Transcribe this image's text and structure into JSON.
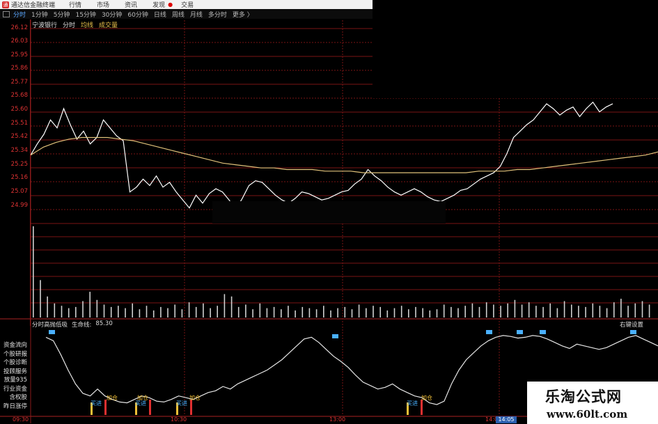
{
  "menu": {
    "title": "通达信金融终端",
    "items": [
      "行情",
      "市场",
      "资讯",
      "发现",
      "交易"
    ]
  },
  "period_tabs": [
    "分时",
    "1分钟",
    "5分钟",
    "15分钟",
    "30分钟",
    "60分钟",
    "日线",
    "周线",
    "月线",
    "多分时",
    "更多 〉"
  ],
  "active_tab": "分时",
  "stock_header": {
    "name": "宁波银行",
    "mode": "分时",
    "avg": "均线",
    "volume": "成交量"
  },
  "price_axis": [
    "26.12",
    "26.03",
    "25.95",
    "25.86",
    "25.77",
    "25.68",
    "25.60",
    "25.51",
    "25.42",
    "25.34",
    "25.25",
    "25.16",
    "25.07",
    "24.99"
  ],
  "indicator_header": {
    "name": "分时高抛低吸",
    "line_label": "生命线:",
    "line_value": "85.30"
  },
  "right_settings": "右键设置",
  "side_menu": [
    "资金流向",
    "个股研报",
    "个股诊断",
    "投顾服务",
    "放量935",
    "行业资金",
    "含权股",
    "昨日涨停"
  ],
  "time_axis": [
    "09:30",
    "10:30",
    "13:00",
    "14:00"
  ],
  "current_time": "14:05",
  "signals": {
    "buy_label": "买进",
    "add_label": "加仓"
  },
  "watermark": {
    "line1": "乐淘公式网",
    "line2": "www.60lt.com"
  },
  "colors": {
    "price_line": "#ffffff",
    "avg_line": "#e0c27a",
    "grid": "#7a1515",
    "axis_text": "#dd3333",
    "buy": "#4ab0ff",
    "add": "#f2c037"
  },
  "chart_data": {
    "type": "line",
    "ylim": [
      24.99,
      26.12
    ],
    "series": [
      {
        "values": [
          25.33,
          25.4,
          25.46,
          25.55,
          25.5,
          25.62,
          25.52,
          25.43,
          25.48,
          25.4,
          25.44,
          25.55,
          25.5,
          25.45,
          25.42,
          25.1,
          25.13,
          25.18,
          25.14,
          25.2,
          25.13,
          25.16,
          25.1,
          25.05,
          25.0,
          25.08,
          25.03,
          25.09,
          25.12,
          25.1,
          25.05,
          24.99,
          25.06,
          25.14,
          25.17,
          25.16,
          25.12,
          25.08,
          25.05,
          25.03,
          25.06,
          25.1,
          25.09,
          25.07,
          25.05,
          25.06,
          25.08,
          25.1,
          25.11,
          25.15,
          25.18,
          25.24,
          25.2,
          25.17,
          25.13,
          25.1,
          25.08,
          25.1,
          25.12,
          25.1,
          25.07,
          25.05,
          25.04,
          25.06,
          25.08,
          25.11,
          25.12,
          25.15,
          25.18,
          25.2,
          25.22,
          25.26,
          25.34,
          25.44,
          25.48,
          25.52,
          25.55,
          25.6,
          25.65,
          25.62,
          25.58,
          25.61,
          25.63,
          25.57,
          25.62,
          25.66,
          25.6,
          25.63,
          25.65
        ]
      },
      {
        "values": [
          25.33,
          25.38,
          25.41,
          25.43,
          25.44,
          25.44,
          25.44,
          25.43,
          25.42,
          25.4,
          25.38,
          25.36,
          25.34,
          25.32,
          25.3,
          25.28,
          25.27,
          25.26,
          25.25,
          25.25,
          25.24,
          25.24,
          25.24,
          25.23,
          25.23,
          25.23,
          25.22,
          25.22,
          25.22,
          25.22,
          25.22,
          25.22,
          25.22,
          25.22,
          25.22,
          25.23,
          25.23,
          25.23,
          25.24,
          25.24,
          25.25,
          25.26,
          25.27,
          25.28,
          25.29,
          25.3,
          25.31,
          25.32,
          25.33,
          25.35
        ]
      }
    ],
    "volume": [
      78,
      32,
      18,
      12,
      10,
      8,
      9,
      14,
      22,
      15,
      11,
      9,
      10,
      8,
      12,
      7,
      10,
      6,
      9,
      8,
      11,
      7,
      13,
      9,
      12,
      8,
      10,
      20,
      18,
      9,
      11,
      7,
      12,
      8,
      9,
      7,
      10,
      6,
      9,
      8,
      7,
      10,
      6,
      8,
      9,
      7,
      11,
      8,
      10,
      9,
      6,
      8,
      10,
      7,
      9,
      8,
      6,
      7,
      11,
      9,
      8,
      10,
      12,
      9,
      13,
      11,
      10,
      12,
      15,
      11,
      13,
      10,
      9,
      12,
      8,
      14,
      11,
      10,
      9,
      12,
      10,
      8,
      13,
      16,
      10,
      12,
      14,
      11
    ],
    "indicator": [
      90,
      86,
      70,
      52,
      36,
      25,
      22,
      30,
      22,
      18,
      15,
      14,
      18,
      22,
      20,
      16,
      15,
      18,
      22,
      20,
      18,
      22,
      26,
      28,
      33,
      30,
      36,
      40,
      44,
      48,
      52,
      58,
      64,
      72,
      80,
      88,
      90,
      84,
      76,
      68,
      62,
      55,
      46,
      38,
      34,
      30,
      32,
      36,
      30,
      26,
      22,
      20,
      14,
      12,
      16,
      36,
      52,
      64,
      72,
      80,
      86,
      90,
      92,
      91,
      89,
      90,
      92,
      91,
      88,
      84,
      80,
      77,
      82,
      80,
      78,
      76,
      78,
      82,
      86,
      90,
      92,
      88,
      84,
      80
    ]
  }
}
